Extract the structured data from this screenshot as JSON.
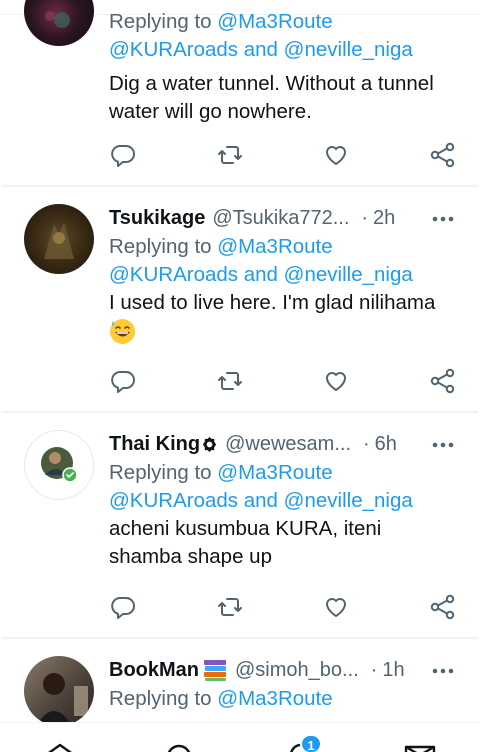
{
  "tweets": [
    {
      "replying_prefix": "Replying to",
      "mention1": "@Ma3Route",
      "mention2": "@KURAroads",
      "and": "and",
      "mention3": "@neville_niga",
      "text_line1": "Dig a water tunnel. Without a tunnel",
      "text_line2": "water will go nowhere."
    },
    {
      "name": "Tsukikage",
      "handle": "@Tsukika772...",
      "dot": "·",
      "time": "2h",
      "replying_prefix": "Replying to",
      "mention1": "@Ma3Route",
      "mention2": "@KURAroads",
      "and": "and",
      "mention3": "@neville_niga",
      "text_line1": "I used to live here. I'm glad nilihama",
      "emoji": "sweat-smile-emoji"
    },
    {
      "name": "Thai King",
      "handle": "@wewesam...",
      "dot": "·",
      "time": "6h",
      "replying_prefix": "Replying to",
      "mention1": "@Ma3Route",
      "mention2": "@KURAroads",
      "and": "and",
      "mention3": "@neville_niga",
      "text_line1": "acheni kusumbua KURA, iteni",
      "text_line2": "shamba shape up"
    },
    {
      "name": "BookMan",
      "handle": "@simoh_bo...",
      "dot": "·",
      "time": "1h",
      "replying_prefix": "Replying to",
      "mention1": "@Ma3Route"
    }
  ],
  "nav": {
    "notification_badge": "1"
  },
  "colors": {
    "link": "#1d9bf0",
    "secondary": "#536471",
    "primary": "#0f1419",
    "divider": "#eff3f4"
  },
  "icons": [
    "reply-icon",
    "retweet-icon",
    "like-icon",
    "share-icon",
    "more-icon",
    "home-icon",
    "search-icon",
    "notifications-icon",
    "messages-icon"
  ]
}
